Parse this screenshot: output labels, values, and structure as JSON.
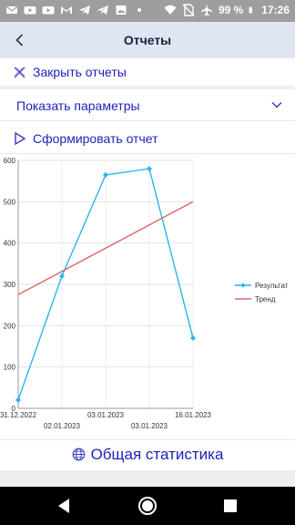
{
  "status_bar": {
    "battery": "99 %",
    "time": "17:26",
    "icons": [
      "email-icon",
      "youtube-icon",
      "youtube-icon",
      "gmail-icon",
      "telegram-icon",
      "telegram-icon",
      "image-icon",
      "dot-icon",
      "wifi-icon",
      "no-sim-icon",
      "airplane-icon",
      "battery-icon"
    ]
  },
  "app_bar": {
    "title": "Отчеты",
    "back_icon": "chevron-left-icon"
  },
  "actions": {
    "close_reports": "Закрыть отчеты",
    "show_params": "Показать параметры",
    "generate_report": "Сформировать отчет"
  },
  "chart_data": {
    "type": "line",
    "y_ticks": [
      "600",
      "500",
      "400",
      "300",
      "200",
      "100",
      "0"
    ],
    "ylim": [
      0,
      600
    ],
    "x_tick_labels": [
      {
        "label": "31.12.2022",
        "row": 1
      },
      {
        "label": "02.01.2023",
        "row": 2
      },
      {
        "label": "03.01.2023",
        "row": 1
      },
      {
        "label": "03.01.2023",
        "row": 2
      },
      {
        "label": "16.01.2023",
        "row": 1
      }
    ],
    "categories": [
      "31.12.2022",
      "02.01.2023",
      "03.01.2023",
      "03.01.2023",
      "16.01.2023"
    ],
    "series": [
      {
        "name": "Результат",
        "color": "#29b6e6",
        "marker": "diamond",
        "values": [
          20,
          320,
          565,
          580,
          170
        ]
      },
      {
        "name": "Тренд",
        "color": "#e06666",
        "marker": "none",
        "values": [
          275,
          null,
          null,
          null,
          500
        ]
      }
    ],
    "legend_position": "right",
    "grid": true
  },
  "footer": {
    "label": "Общая статистика",
    "icon": "globe-icon"
  },
  "nav": {
    "back": "back-triangle-icon",
    "home": "home-circle-icon",
    "recent": "recent-square-icon"
  }
}
